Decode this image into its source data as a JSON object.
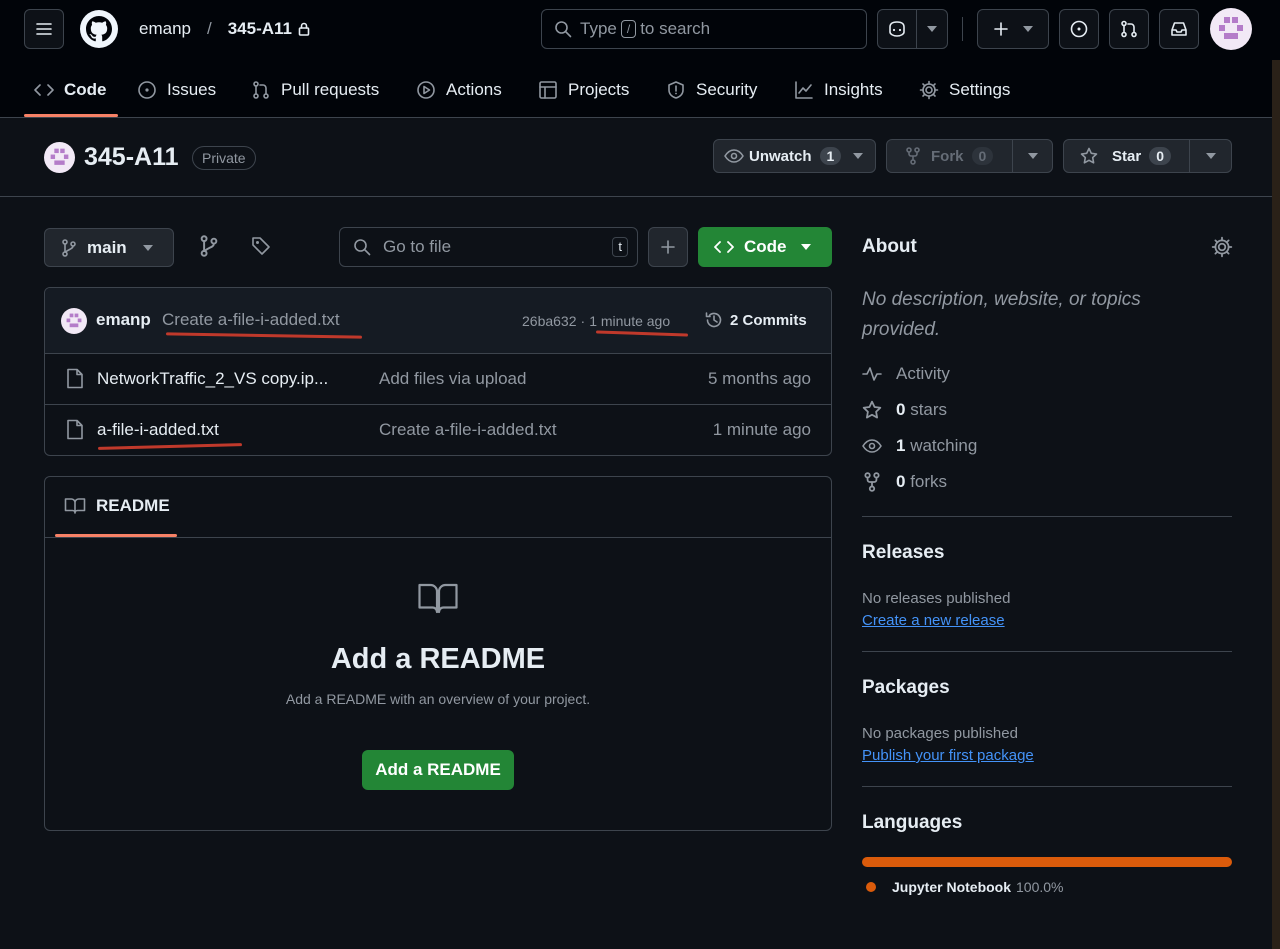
{
  "header": {
    "owner": "emanp",
    "separator": "/",
    "repo": "345-A11",
    "search_pre": "Type",
    "search_key": "/",
    "search_post": "to search"
  },
  "nav": {
    "tabs": [
      {
        "label": "Code"
      },
      {
        "label": "Issues"
      },
      {
        "label": "Pull requests"
      },
      {
        "label": "Actions"
      },
      {
        "label": "Projects"
      },
      {
        "label": "Security"
      },
      {
        "label": "Insights"
      },
      {
        "label": "Settings"
      }
    ]
  },
  "repo_header": {
    "title": "345-A11",
    "visibility": "Private",
    "unwatch_label": "Unwatch",
    "watch_count": "1",
    "fork_label": "Fork",
    "fork_count": "0",
    "star_label": "Star",
    "star_count": "0"
  },
  "toolbar": {
    "branch": "main",
    "goto_placeholder": "Go to file",
    "goto_key": "t",
    "code_label": "Code"
  },
  "commit": {
    "author": "emanp",
    "message": "Create a-file-i-added.txt",
    "sha": "26ba632",
    "dot": "·",
    "time": "1 minute ago",
    "commits_label": "2 Commits"
  },
  "files": [
    {
      "name": "NetworkTraffic_2_VS copy.ip...",
      "message": "Add files via upload",
      "time": "5 months ago"
    },
    {
      "name": "a-file-i-added.txt",
      "message": "Create a-file-i-added.txt",
      "time": "1 minute ago"
    }
  ],
  "readme": {
    "tab_label": "README",
    "heading": "Add a README",
    "description": "Add a README with an overview of your project.",
    "button": "Add a README"
  },
  "about": {
    "title": "About",
    "description": "No description, website, or topics provided.",
    "activity": "Activity",
    "stars_count": "0",
    "stars_label": "stars",
    "watching_count": "1",
    "watching_label": "watching",
    "forks_count": "0",
    "forks_label": "forks"
  },
  "releases": {
    "title": "Releases",
    "empty": "No releases published",
    "link": "Create a new release"
  },
  "packages": {
    "title": "Packages",
    "empty": "No packages published",
    "link": "Publish your first package"
  },
  "languages": {
    "title": "Languages",
    "items": [
      {
        "name": "Jupyter Notebook",
        "percent": "100.0%",
        "fraction": 1.0,
        "color": "#da5b0b"
      }
    ]
  },
  "colors": {
    "accent_green": "#238636",
    "annotation_red": "#c0392b",
    "tab_underline": "#f78166",
    "link": "#4493f8"
  }
}
